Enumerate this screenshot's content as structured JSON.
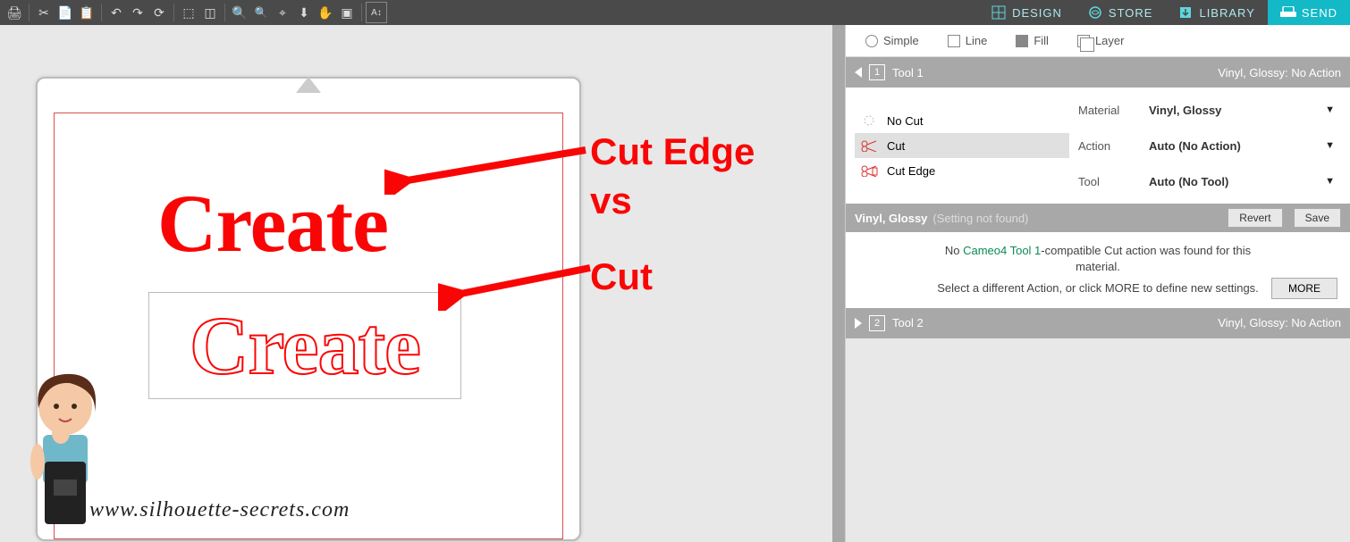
{
  "nav": {
    "design": "DESIGN",
    "store": "STORE",
    "library": "LIBRARY",
    "send": "SEND"
  },
  "subtabs": {
    "simple": "Simple",
    "line": "Line",
    "fill": "Fill",
    "layer": "Layer"
  },
  "tool1": {
    "title": "Tool 1",
    "status_prefix": "Vinyl, Glossy: ",
    "status_action": "No Action",
    "cut_options": {
      "no_cut": "No Cut",
      "cut": "Cut",
      "cut_edge": "Cut Edge"
    },
    "props": {
      "material_label": "Material",
      "material_value": "Vinyl, Glossy",
      "action_label": "Action",
      "action_value": "Auto (No Action)",
      "tool_label": "Tool",
      "tool_value": "Auto (No Tool)"
    }
  },
  "settings_bar": {
    "name": "Vinyl, Glossy",
    "note": "(Setting not found)",
    "revert": "Revert",
    "save": "Save"
  },
  "message": {
    "line1a": "No ",
    "line1_link": "Cameo4 Tool 1",
    "line1b": "-compatible Cut action was found for this material.",
    "line2": "Select a different Action, or click MORE to define new settings.",
    "more": "MORE"
  },
  "tool2": {
    "title": "Tool 2",
    "status_prefix": "Vinyl, Glossy: ",
    "status_action": "No Action"
  },
  "canvas": {
    "word1": "Create",
    "word2": "Create"
  },
  "annotations": {
    "line1": "Cut Edge",
    "line2": "vs",
    "line3": "Cut"
  },
  "watermark": "www.silhouette-secrets.com"
}
